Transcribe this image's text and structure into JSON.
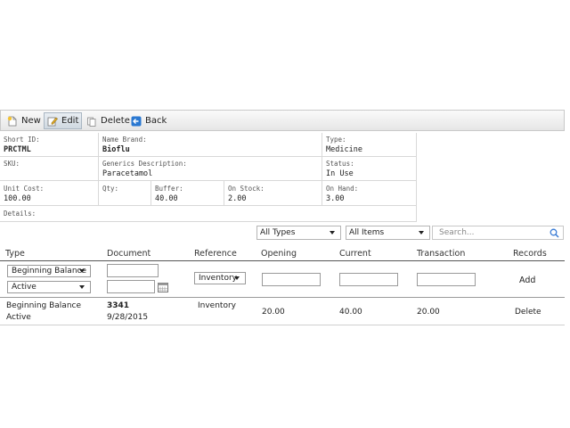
{
  "toolbar": {
    "new_label": "New",
    "edit_label": "Edit",
    "delete_label": "Delete",
    "back_label": "Back"
  },
  "details": {
    "short_id_label": "Short ID:",
    "short_id": "PRCTML",
    "brand_label": "Name Brand:",
    "brand": "Bioflu",
    "type_label": "Type:",
    "type": "Medicine",
    "sku_label": "SKU:",
    "generic_label": "Generics Description:",
    "generic": "Paracetamol",
    "status_label": "Status:",
    "status": "In Use",
    "unit_cost_label": "Unit Cost:",
    "unit_cost": "100.00",
    "qty_label": "Qty:",
    "buffer_label": "Buffer:",
    "buffer": "40.00",
    "on_stock_label": "On Stock:",
    "on_stock": "2.00",
    "on_hand_label": "On Hand:",
    "on_hand": "3.00",
    "details_label": "Details:"
  },
  "filters": {
    "types_selected": "All Types",
    "items_selected": "All Items",
    "search_placeholder": "Search..."
  },
  "table": {
    "headers": [
      "Type",
      "Document",
      "Reference",
      "Opening",
      "Current",
      "Transaction",
      "Records"
    ],
    "edit_row": {
      "type_selected": "Beginning Balance",
      "status_selected": "Active",
      "reference_selected": "Inventory",
      "add_label": "Add"
    },
    "rows": [
      {
        "type": "Beginning Balance",
        "status": "Active",
        "document": "3341",
        "date": "9/28/2015",
        "reference": "Inventory",
        "opening": "20.00",
        "current": "40.00",
        "transaction": "20.00",
        "action": "Delete"
      }
    ]
  }
}
